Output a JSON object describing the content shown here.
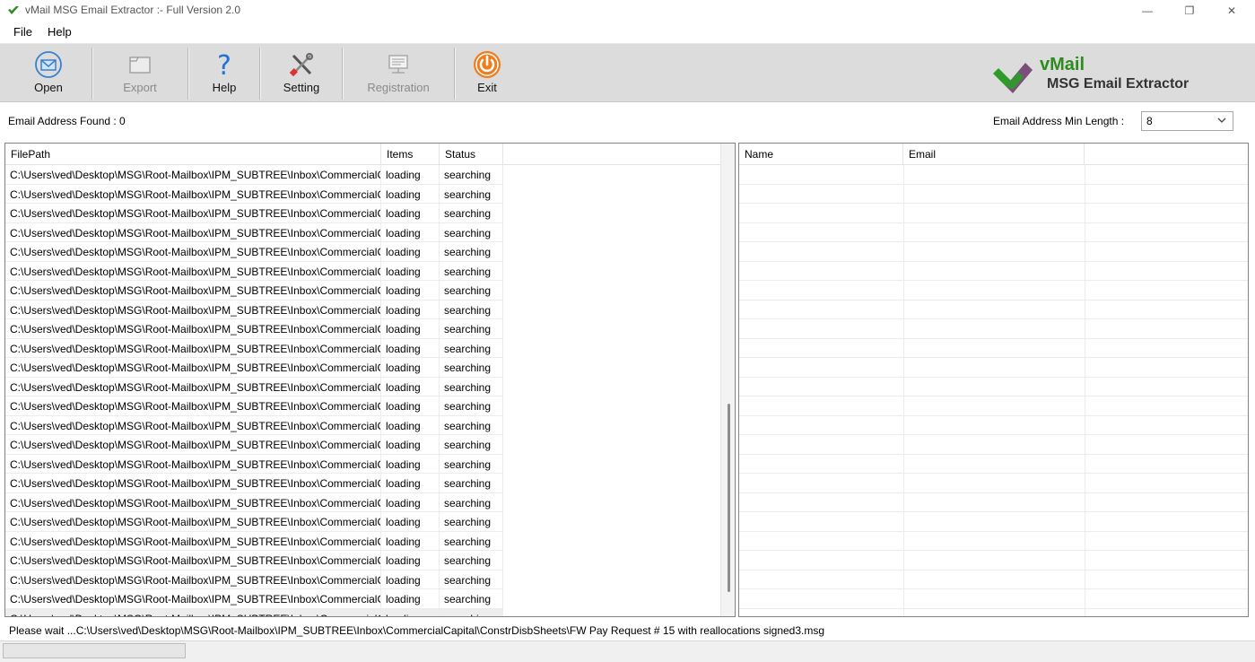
{
  "window": {
    "title": "vMail MSG Email Extractor :- Full Version 2.0",
    "minimize_glyph": "—",
    "maximize_glyph": "❐",
    "close_glyph": "✕"
  },
  "menu": {
    "file": "File",
    "help": "Help"
  },
  "toolbar": {
    "open": "Open",
    "export": "Export",
    "help": "Help",
    "setting": "Setting",
    "registration": "Registration",
    "exit": "Exit"
  },
  "brand": {
    "name": "vMail",
    "subtitle": "MSG Email Extractor"
  },
  "info": {
    "found_label": "Email Address Found :  0",
    "min_length_label": "Email Address Min Length :",
    "min_length_value": "8"
  },
  "files_table": {
    "headers": {
      "filepath": "FilePath",
      "items": "Items",
      "status": "Status"
    },
    "rows": [
      {
        "filepath": "C:\\Users\\ved\\Desktop\\MSG\\Root-Mailbox\\IPM_SUBTREE\\Inbox\\CommercialCa...",
        "items": "loading",
        "status": "searching"
      },
      {
        "filepath": "C:\\Users\\ved\\Desktop\\MSG\\Root-Mailbox\\IPM_SUBTREE\\Inbox\\CommercialCa...",
        "items": "loading",
        "status": "searching"
      },
      {
        "filepath": "C:\\Users\\ved\\Desktop\\MSG\\Root-Mailbox\\IPM_SUBTREE\\Inbox\\CommercialCa...",
        "items": "loading",
        "status": "searching"
      },
      {
        "filepath": "C:\\Users\\ved\\Desktop\\MSG\\Root-Mailbox\\IPM_SUBTREE\\Inbox\\CommercialCa...",
        "items": "loading",
        "status": "searching"
      },
      {
        "filepath": "C:\\Users\\ved\\Desktop\\MSG\\Root-Mailbox\\IPM_SUBTREE\\Inbox\\CommercialCa...",
        "items": "loading",
        "status": "searching"
      },
      {
        "filepath": "C:\\Users\\ved\\Desktop\\MSG\\Root-Mailbox\\IPM_SUBTREE\\Inbox\\CommercialCa...",
        "items": "loading",
        "status": "searching"
      },
      {
        "filepath": "C:\\Users\\ved\\Desktop\\MSG\\Root-Mailbox\\IPM_SUBTREE\\Inbox\\CommercialCa...",
        "items": "loading",
        "status": "searching"
      },
      {
        "filepath": "C:\\Users\\ved\\Desktop\\MSG\\Root-Mailbox\\IPM_SUBTREE\\Inbox\\CommercialCa...",
        "items": "loading",
        "status": "searching"
      },
      {
        "filepath": "C:\\Users\\ved\\Desktop\\MSG\\Root-Mailbox\\IPM_SUBTREE\\Inbox\\CommercialCa...",
        "items": "loading",
        "status": "searching"
      },
      {
        "filepath": "C:\\Users\\ved\\Desktop\\MSG\\Root-Mailbox\\IPM_SUBTREE\\Inbox\\CommercialCa...",
        "items": "loading",
        "status": "searching"
      },
      {
        "filepath": "C:\\Users\\ved\\Desktop\\MSG\\Root-Mailbox\\IPM_SUBTREE\\Inbox\\CommercialCa...",
        "items": "loading",
        "status": "searching"
      },
      {
        "filepath": "C:\\Users\\ved\\Desktop\\MSG\\Root-Mailbox\\IPM_SUBTREE\\Inbox\\CommercialCa...",
        "items": "loading",
        "status": "searching"
      },
      {
        "filepath": "C:\\Users\\ved\\Desktop\\MSG\\Root-Mailbox\\IPM_SUBTREE\\Inbox\\CommercialCa...",
        "items": "loading",
        "status": "searching"
      },
      {
        "filepath": "C:\\Users\\ved\\Desktop\\MSG\\Root-Mailbox\\IPM_SUBTREE\\Inbox\\CommercialCa...",
        "items": "loading",
        "status": "searching"
      },
      {
        "filepath": "C:\\Users\\ved\\Desktop\\MSG\\Root-Mailbox\\IPM_SUBTREE\\Inbox\\CommercialCa...",
        "items": "loading",
        "status": "searching"
      },
      {
        "filepath": "C:\\Users\\ved\\Desktop\\MSG\\Root-Mailbox\\IPM_SUBTREE\\Inbox\\CommercialCa...",
        "items": "loading",
        "status": "searching"
      },
      {
        "filepath": "C:\\Users\\ved\\Desktop\\MSG\\Root-Mailbox\\IPM_SUBTREE\\Inbox\\CommercialCa...",
        "items": "loading",
        "status": "searching"
      },
      {
        "filepath": "C:\\Users\\ved\\Desktop\\MSG\\Root-Mailbox\\IPM_SUBTREE\\Inbox\\CommercialCa...",
        "items": "loading",
        "status": "searching"
      },
      {
        "filepath": "C:\\Users\\ved\\Desktop\\MSG\\Root-Mailbox\\IPM_SUBTREE\\Inbox\\CommercialCa...",
        "items": "loading",
        "status": "searching"
      },
      {
        "filepath": "C:\\Users\\ved\\Desktop\\MSG\\Root-Mailbox\\IPM_SUBTREE\\Inbox\\CommercialCa...",
        "items": "loading",
        "status": "searching"
      },
      {
        "filepath": "C:\\Users\\ved\\Desktop\\MSG\\Root-Mailbox\\IPM_SUBTREE\\Inbox\\CommercialCa...",
        "items": "loading",
        "status": "searching"
      },
      {
        "filepath": "C:\\Users\\ved\\Desktop\\MSG\\Root-Mailbox\\IPM_SUBTREE\\Inbox\\CommercialCa...",
        "items": "loading",
        "status": "searching"
      },
      {
        "filepath": "C:\\Users\\ved\\Desktop\\MSG\\Root-Mailbox\\IPM_SUBTREE\\Inbox\\CommercialCa...",
        "items": "loading",
        "status": "searching"
      },
      {
        "filepath": "C:\\Users\\ved\\Desktop\\MSG\\Root-Mailbox\\IPM_SUBTREE\\Inbox\\CommercialCa...",
        "items": "loading",
        "status": "searching"
      }
    ]
  },
  "emails_table": {
    "headers": {
      "name": "Name",
      "email": "Email"
    },
    "rows": []
  },
  "status": {
    "message": "Please wait ...C:\\Users\\ved\\Desktop\\MSG\\Root-Mailbox\\IPM_SUBTREE\\Inbox\\CommercialCapital\\ConstrDisbSheets\\FW Pay Request # 15 with reallocations signed3.msg"
  },
  "colors": {
    "brand_green": "#2e8b1e",
    "exit_orange": "#f07c1e",
    "toolbar_bg": "#dcdcdc"
  },
  "icons": [
    "app-icon",
    "open-envelope-icon",
    "export-folder-icon",
    "help-question-icon",
    "setting-tools-icon",
    "registration-icon",
    "exit-power-icon",
    "dropdown-chevron-icon"
  ]
}
